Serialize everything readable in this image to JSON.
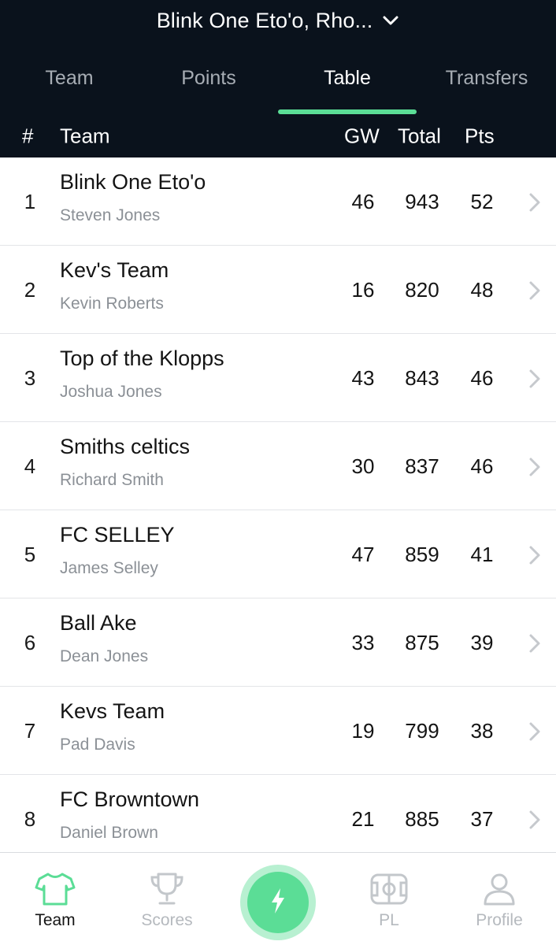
{
  "header": {
    "title": "Blink One Eto'o, Rho...",
    "tabs": [
      {
        "label": "Team"
      },
      {
        "label": "Points"
      },
      {
        "label": "Table"
      },
      {
        "label": "Transfers"
      }
    ],
    "active_tab": "Table",
    "columns": {
      "rank": "#",
      "team": "Team",
      "gw": "GW",
      "total": "Total",
      "pts": "Pts"
    }
  },
  "table": {
    "rows": [
      {
        "rank": "1",
        "team": "Blink One Eto'o",
        "manager": "Steven Jones",
        "gw": "46",
        "total": "943",
        "pts": "52"
      },
      {
        "rank": "2",
        "team": "Kev's Team",
        "manager": "Kevin Roberts",
        "gw": "16",
        "total": "820",
        "pts": "48"
      },
      {
        "rank": "3",
        "team": "Top of the Klopps",
        "manager": "Joshua Jones",
        "gw": "43",
        "total": "843",
        "pts": "46"
      },
      {
        "rank": "4",
        "team": "Smiths celtics",
        "manager": "Richard Smith",
        "gw": "30",
        "total": "837",
        "pts": "46"
      },
      {
        "rank": "5",
        "team": "FC SELLEY",
        "manager": "James Selley",
        "gw": "47",
        "total": "859",
        "pts": "41"
      },
      {
        "rank": "6",
        "team": "Ball Ake",
        "manager": "Dean Jones",
        "gw": "33",
        "total": "875",
        "pts": "39"
      },
      {
        "rank": "7",
        "team": "Kevs Team",
        "manager": "Pad Davis",
        "gw": "19",
        "total": "799",
        "pts": "38"
      },
      {
        "rank": "8",
        "team": "FC Browntown",
        "manager": "Daniel Brown",
        "gw": "21",
        "total": "885",
        "pts": "37"
      }
    ]
  },
  "bottom_nav": {
    "items": [
      {
        "label": "Team",
        "icon": "shirt-icon"
      },
      {
        "label": "Scores",
        "icon": "trophy-icon"
      },
      {
        "label": "",
        "icon": "lightning-icon"
      },
      {
        "label": "PL",
        "icon": "pitch-icon"
      },
      {
        "label": "Profile",
        "icon": "person-icon"
      }
    ],
    "active": "Team"
  },
  "colors": {
    "header_bg": "#0a121c",
    "accent": "#5bdd96",
    "muted_text": "#8b9096"
  }
}
